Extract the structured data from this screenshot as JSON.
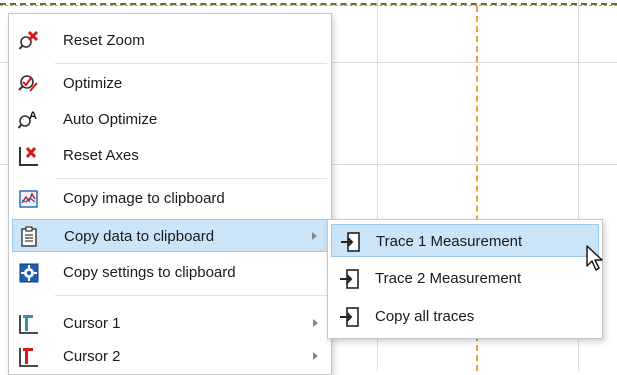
{
  "colors": {
    "highlight": "#cce4f7",
    "highlight_border": "#99c9ef",
    "cursor_line": "#f0a040",
    "icon_red": "#d41919",
    "icon_blue": "#1f5fb3",
    "icon_teal": "#3a8fa3"
  },
  "context_menu": {
    "items": [
      {
        "label": "Reset Zoom",
        "icon": "reset-zoom-icon"
      },
      {
        "label": "Optimize",
        "icon": "optimize-icon"
      },
      {
        "label": "Auto Optimize",
        "icon": "auto-optimize-icon"
      },
      {
        "label": "Reset Axes",
        "icon": "reset-axes-icon"
      },
      {
        "label": "Copy image to clipboard",
        "icon": "image-clipboard-icon"
      },
      {
        "label": "Copy data to clipboard",
        "icon": "data-clipboard-icon",
        "has_submenu": true,
        "highlighted": true
      },
      {
        "label": "Copy settings to clipboard",
        "icon": "settings-clipboard-icon"
      },
      {
        "label": "Cursor 1",
        "icon": "cursor-1-icon",
        "has_submenu": true
      },
      {
        "label": "Cursor 2",
        "icon": "cursor-2-icon",
        "has_submenu": true
      }
    ]
  },
  "submenu": {
    "items": [
      {
        "label": "Trace 1 Measurement",
        "icon": "export-trace-icon",
        "highlighted": true
      },
      {
        "label": "Trace 2 Measurement",
        "icon": "export-trace-icon"
      },
      {
        "label": "Copy all traces",
        "icon": "export-trace-icon"
      }
    ]
  }
}
